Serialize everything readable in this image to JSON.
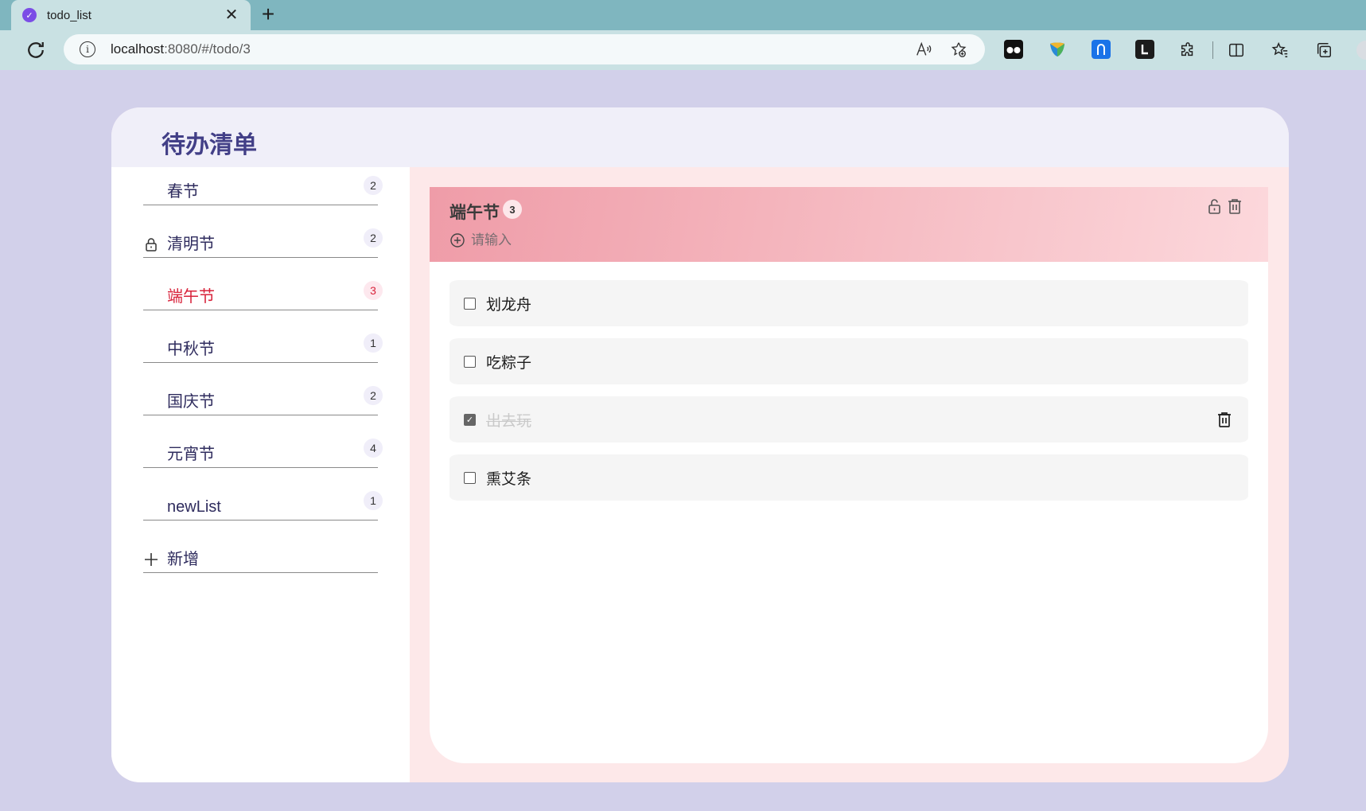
{
  "browser": {
    "tab_title": "todo_list",
    "url_host": "localhost",
    "url_rest": ":8080/#/todo/3"
  },
  "app": {
    "title": "待办清单"
  },
  "sidebar": {
    "items": [
      {
        "label": "春节",
        "count": "2",
        "locked": false,
        "active": false
      },
      {
        "label": "清明节",
        "count": "2",
        "locked": true,
        "active": false
      },
      {
        "label": "端午节",
        "count": "3",
        "locked": false,
        "active": true
      },
      {
        "label": "中秋节",
        "count": "1",
        "locked": false,
        "active": false
      },
      {
        "label": "国庆节",
        "count": "2",
        "locked": false,
        "active": false
      },
      {
        "label": "元宵节",
        "count": "4",
        "locked": false,
        "active": false
      },
      {
        "label": "newList",
        "count": "1",
        "locked": false,
        "active": false
      }
    ],
    "add_label": "新增"
  },
  "main": {
    "title": "端午节",
    "count": "3",
    "input_placeholder": "请输入",
    "todos": [
      {
        "text": "划龙舟",
        "done": false
      },
      {
        "text": "吃粽子",
        "done": false
      },
      {
        "text": "出去玩",
        "done": true
      },
      {
        "text": "熏艾条",
        "done": false
      }
    ]
  }
}
